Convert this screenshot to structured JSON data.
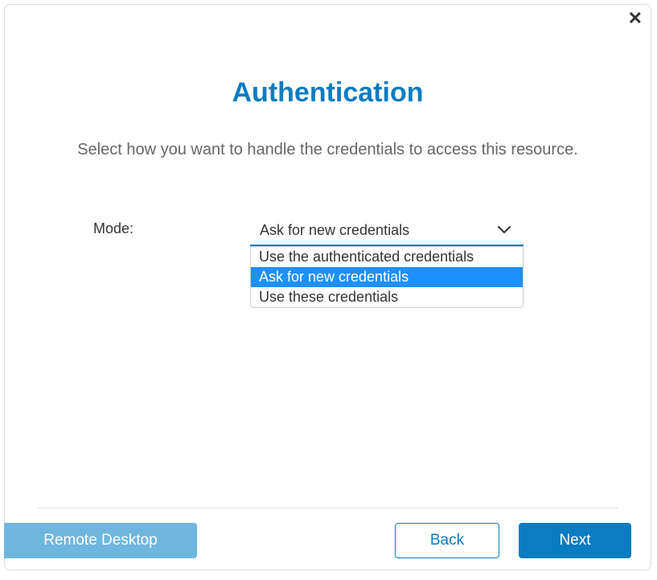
{
  "title": "Authentication",
  "subtitle": "Select how you want to handle the credentials to access this resource.",
  "form": {
    "mode_label": "Mode:",
    "mode_selected": "Ask for new credentials",
    "mode_options": {
      "opt0": "Use the authenticated credentials",
      "opt1": "Ask for new credentials",
      "opt2": "Use these credentials"
    }
  },
  "footer": {
    "remote_desktop": "Remote Desktop",
    "back": "Back",
    "next": "Next"
  }
}
